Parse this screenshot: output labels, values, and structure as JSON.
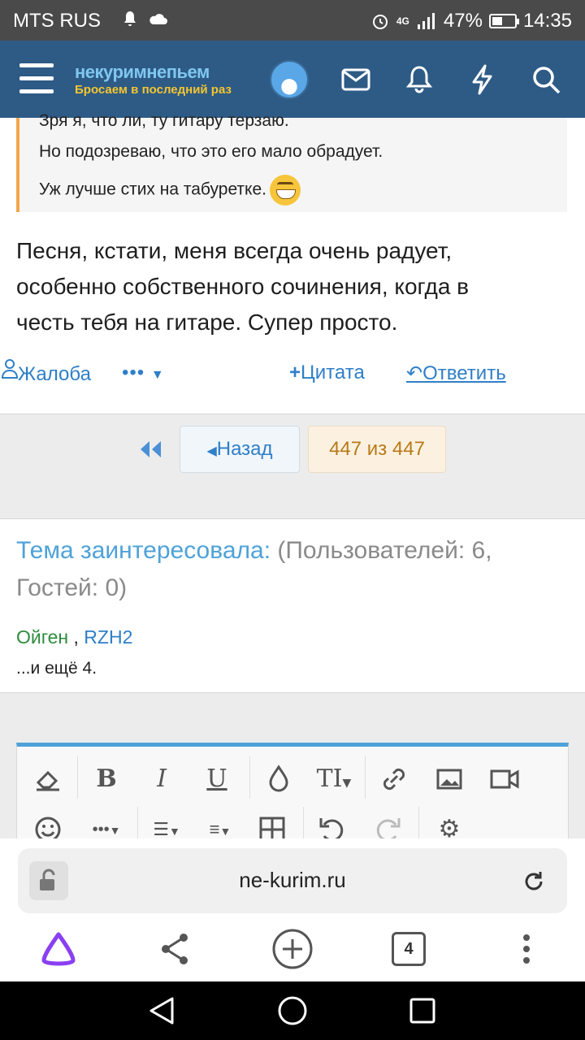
{
  "status": {
    "carrier": "MTS RUS",
    "network": "4G",
    "battery": "47%",
    "battery_level": 0.47,
    "time": "14:35"
  },
  "header": {
    "logo_line1": "некуримнепьем",
    "logo_line2": "Бросаем в последний раз"
  },
  "post": {
    "quote_lines": [
      "Зря я, что ли, ту гитару терзаю.",
      "Но подозреваю, что это его мало обрадует.",
      "Уж лучше стих на табуретке."
    ],
    "body_lines": [
      "Песня, кстати, меня всегда очень радует,",
      "особенно собственного сочинения, когда в",
      "честь тебя на гитаре. Супер просто."
    ],
    "actions": {
      "report": "Жалоба",
      "more": "•••",
      "quote": "Цитата",
      "reply": "Ответить"
    }
  },
  "pager": {
    "back": "Назад",
    "count": "447 из 447"
  },
  "viewers": {
    "title_accent": "Тема заинтересовала:",
    "title_rest": "(Пользователей: 6, Гостей: 0)",
    "user1": "Ойген",
    "separator": ",",
    "user2": "RZH2",
    "more": "...и ещё 4."
  },
  "browser": {
    "url": "ne-kurim.ru",
    "tabs_count": "4"
  },
  "colors": {
    "header_bg": "#2e5b86",
    "link": "#2f7fc8",
    "accent": "#4ea2d8",
    "quote_border": "#f3a74a"
  }
}
